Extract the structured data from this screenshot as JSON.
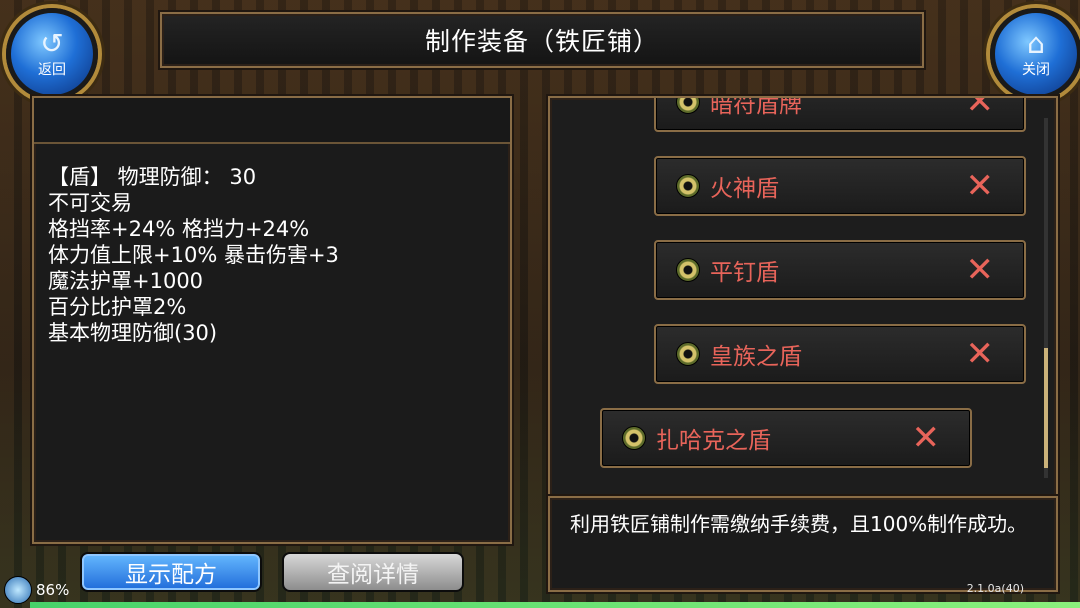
{
  "header": {
    "title": "制作装备（铁匠铺）",
    "back_label": "返回",
    "close_label": "关闭"
  },
  "item_stats": {
    "lines": [
      "【盾】 物理防御： 30",
      "不可交易",
      "格挡率+24% 格挡力+24%",
      "体力值上限+10% 暴击伤害+3",
      "魔法护罩+1000",
      "百分比护罩2%",
      "基本物理防御(30)"
    ]
  },
  "recipes": [
    {
      "name": "暗符盾牌"
    },
    {
      "name": "火神盾"
    },
    {
      "name": "平钉盾"
    },
    {
      "name": "皇族之盾"
    },
    {
      "name": "扎哈克之盾"
    }
  ],
  "description": "利用铁匠铺制作需缴纳手续费，且100%制作成功。",
  "buttons": {
    "show_recipe": "显示配方",
    "view_details": "查阅详情"
  },
  "status": {
    "battery": "86%",
    "version": "2.1.0a(40)"
  },
  "colors": {
    "recipe_text": "#e8645a",
    "accent_blue": "#1f6bd9",
    "frame_gold": "#8a6d46"
  }
}
